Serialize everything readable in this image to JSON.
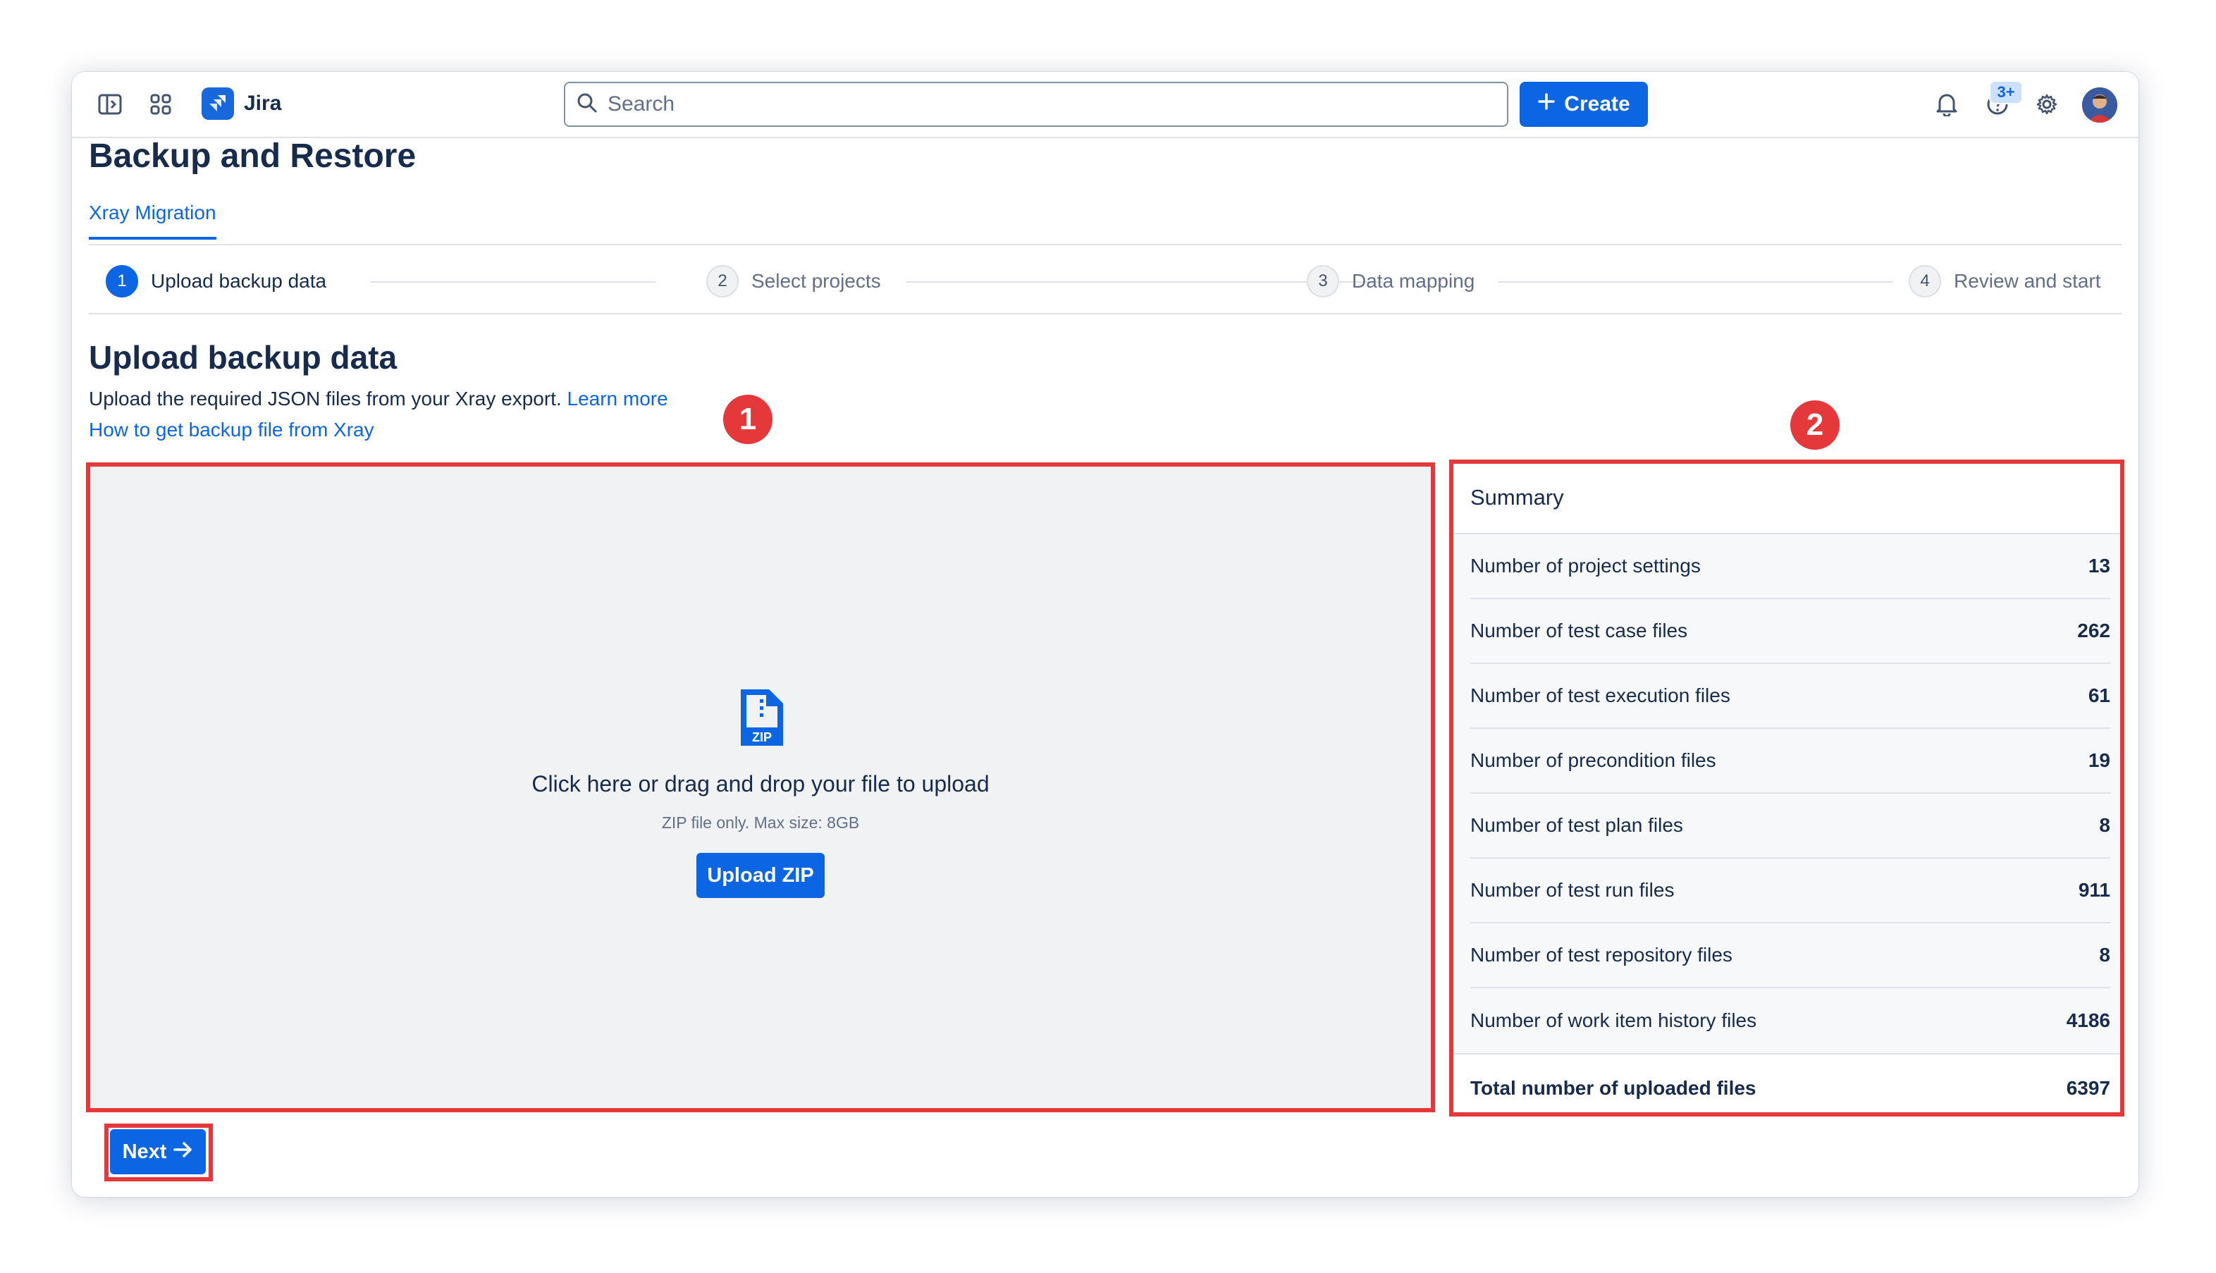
{
  "app": {
    "brand": "Jira",
    "search_placeholder": "Search",
    "create_label": "Create",
    "notification_badge": "3+"
  },
  "page": {
    "title": "Backup and Restore",
    "tab": "Xray Migration"
  },
  "steps": [
    {
      "num": "1",
      "label": "Upload backup data"
    },
    {
      "num": "2",
      "label": "Select projects"
    },
    {
      "num": "3",
      "label": "Data mapping"
    },
    {
      "num": "4",
      "label": "Review and start"
    }
  ],
  "upload": {
    "title": "Upload backup data",
    "description": "Upload the required JSON files from your Xray export.",
    "learn_more": "Learn more",
    "howto_link": "How to get backup file from Xray",
    "file_icon_text": "ZIP",
    "dropzone_title": "Click here or drag and drop your file to upload",
    "dropzone_sub": "ZIP file only. Max size: 8GB",
    "upload_button": "Upload ZIP"
  },
  "summary": {
    "title": "Summary",
    "rows": [
      {
        "label": "Number of project settings",
        "value": "13"
      },
      {
        "label": "Number of test case files",
        "value": "262"
      },
      {
        "label": "Number of test execution files",
        "value": "61"
      },
      {
        "label": "Number of precondition files",
        "value": "19"
      },
      {
        "label": "Number of test plan files",
        "value": "8"
      },
      {
        "label": "Number of test run files",
        "value": "911"
      },
      {
        "label": "Number of test repository files",
        "value": "8"
      },
      {
        "label": "Number of work item history files",
        "value": "4186"
      }
    ],
    "total_label": "Total number of uploaded files",
    "total_value": "6397"
  },
  "footer": {
    "next_label": "Next"
  },
  "annotations": {
    "one": "1",
    "two": "2"
  },
  "colors": {
    "accent": "#0c66e4",
    "annotation": "#e5383b"
  }
}
